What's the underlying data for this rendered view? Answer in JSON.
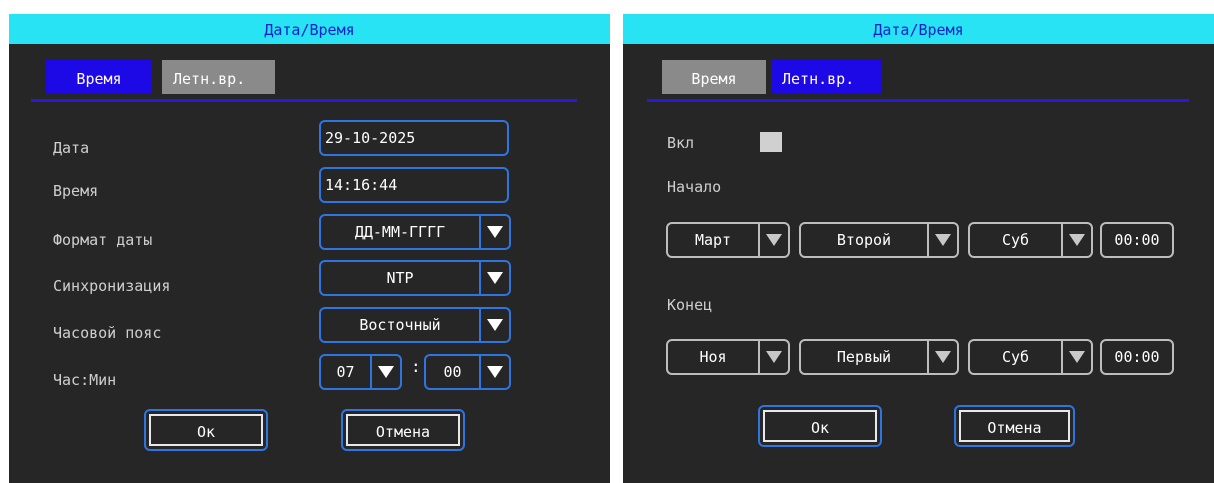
{
  "left": {
    "title": "Дата/Время",
    "tabs": [
      "Время",
      "Летн.вр."
    ],
    "rows": {
      "date": {
        "label": "Дата",
        "value": "29-10-2025"
      },
      "time": {
        "label": "Время",
        "value": "14:16:44"
      },
      "date_format": {
        "label": "Формат даты",
        "value": "ДД-ММ-ГГГГ"
      },
      "sync": {
        "label": "Синхронизация",
        "value": "NTP"
      },
      "timezone": {
        "label": "Часовой пояс",
        "value": "Восточный"
      },
      "hour_min": {
        "label": "Час:Мин",
        "hour": "07",
        "minute": "00",
        "separator": ":"
      }
    },
    "buttons": {
      "ok": "Ок",
      "cancel": "Отмена"
    }
  },
  "right": {
    "title": "Дата/Время",
    "tabs": [
      "Время",
      "Летн.вр."
    ],
    "enable_label": "Вкл",
    "start": {
      "label": "Начало",
      "month": "Март",
      "week": "Второй",
      "day": "Суб",
      "time": "00:00"
    },
    "end": {
      "label": "Конец",
      "month": "Ноя",
      "week": "Первый",
      "day": "Суб",
      "time": "00:00"
    },
    "buttons": {
      "ok": "Ок",
      "cancel": "Отмена"
    }
  },
  "colors": {
    "title_bar": "#27e3f4",
    "title_text": "#0a1fd0",
    "active_tab": "#1d09e6",
    "inactive_tab": "#8a8a8a",
    "field_border": "#2e75e0",
    "panel_bg": "#262626"
  },
  "icons": {
    "dropdown": "triangle-down-icon"
  }
}
